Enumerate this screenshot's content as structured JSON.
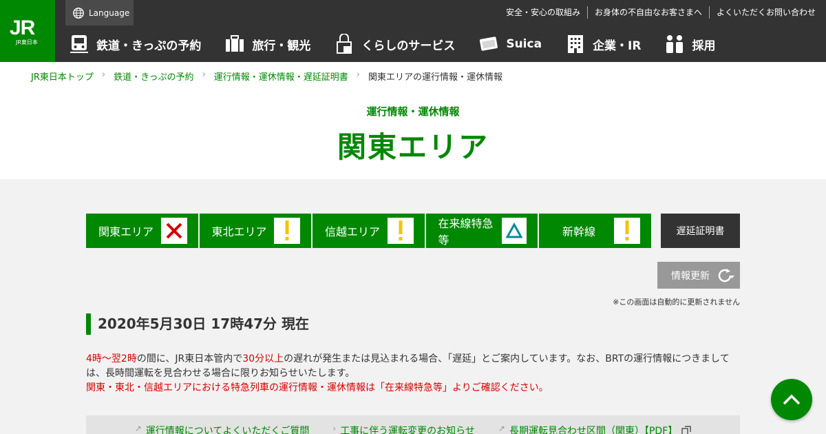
{
  "header": {
    "logo_mark": "JR",
    "logo_sub": "JR東日本",
    "language_label": "Language",
    "util_links": [
      "安全・安心の取組み",
      "お身体の不自由なお客さまへ",
      "よくいただくお問い合わせ"
    ],
    "nav": [
      {
        "label": "鉄道・きっぷの予約",
        "icon": "train-icon"
      },
      {
        "label": "旅行・観光",
        "icon": "suitcase-icon"
      },
      {
        "label": "くらしのサービス",
        "icon": "shopping-bag-icon"
      },
      {
        "label": "Suica",
        "icon": "card-icon"
      },
      {
        "label": "企業・IR",
        "icon": "building-icon"
      },
      {
        "label": "採用",
        "icon": "people-icon"
      }
    ]
  },
  "breadcrumb": [
    "JR東日本トップ",
    "鉄道・きっぷの予約",
    "運行情報・運休情報・遅延証明書",
    "関東エリアの運行情報・運休情報"
  ],
  "page": {
    "subtitle": "運行情報・運休情報",
    "title": "関東エリア"
  },
  "tabs": [
    {
      "label": "関東エリア",
      "status": "×",
      "status_color": "#d60000"
    },
    {
      "label": "東北エリア",
      "status": "!",
      "status_color": "#f5c400"
    },
    {
      "label": "信越エリア",
      "status": "!",
      "status_color": "#f5c400"
    },
    {
      "label": "在来線特急等",
      "status": "△",
      "status_color": "#008b9c"
    },
    {
      "label": "新幹線",
      "status": "!",
      "status_color": "#f5c400"
    }
  ],
  "delay_certificate_label": "遅延証明書",
  "refresh": {
    "label": "情報更新",
    "note": "※この画面は自動的に更新されません"
  },
  "datetime": "2020年5月30日 17時47分 現在",
  "notice": {
    "time_range": "4時～翌2時",
    "part1": "の間に、JR東日本管内で",
    "delay_threshold": "30分以上",
    "part2": "の遅れが発生または見込まれる場合、「遅延」とご案内しています。なお、BRTの運行情報につきましては、長時間運転を見合わせる場合に限りお知らせいたします。",
    "red_line": "関東・東北・信越エリアにおける特急列車の運行情報・運休情報は「在来線特急等」よりご確認ください。"
  },
  "links": [
    {
      "prefix": "↗",
      "label": "運行情報についてよくいただくご質問"
    },
    {
      "prefix": "›",
      "label": "工事に伴う運転変更のお知らせ"
    },
    {
      "prefix": "↗",
      "label": "長期運転見合わせ区間（関東）【PDF】"
    }
  ],
  "colors": {
    "brand_green": "#008803",
    "header_bg": "#333333",
    "alert_red": "#d60000"
  }
}
